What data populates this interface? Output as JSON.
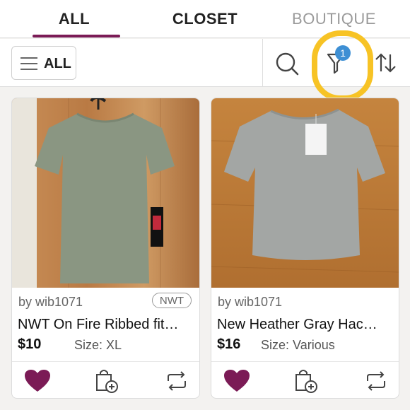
{
  "tabs": [
    {
      "label": "ALL",
      "active": true
    },
    {
      "label": "CLOSET",
      "active": false
    },
    {
      "label": "BOUTIQUE",
      "active": false
    }
  ],
  "toolbar": {
    "filter_label": "ALL",
    "filter_badge": "1",
    "icons": [
      "menu-icon",
      "search-icon",
      "filter-funnel-icon",
      "sort-icon"
    ]
  },
  "listings": [
    {
      "seller": "by wib1071",
      "condition": "NWT",
      "title": "NWT On Fire Ribbed fit…",
      "price": "$10",
      "size": "Size: XL"
    },
    {
      "seller": "by wib1071",
      "condition": "",
      "title": "New Heather Gray Hac…",
      "price": "$16",
      "size": "Size: Various"
    }
  ],
  "colors": {
    "accent": "#7b1b56",
    "badge": "#3d8fd4",
    "highlight": "#f7c325"
  }
}
